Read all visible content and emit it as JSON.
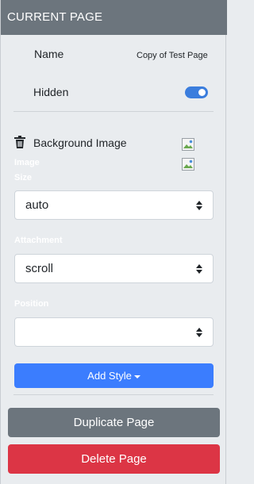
{
  "header": {
    "title": "CURRENT PAGE"
  },
  "page": {
    "name_label": "Name",
    "name_value": "Copy of Test Page",
    "hidden_label": "Hidden",
    "hidden_enabled": true
  },
  "background": {
    "title": "Background Image",
    "image_size_label_line1": "Image",
    "image_size_label_line2": "Size",
    "image_size_value": "auto",
    "attachment_label": "Attachment",
    "attachment_value": "scroll",
    "position_label": "Position",
    "position_value": ""
  },
  "actions": {
    "add_style_label": "Add Style",
    "duplicate_label": "Duplicate Page",
    "delete_label": "Delete Page"
  },
  "colors": {
    "header_bg": "#6c757d",
    "toggle_on": "#3b7ddd",
    "primary": "#3b7dfe",
    "danger": "#dc3545"
  },
  "icons": {
    "trash": "trash-icon",
    "broken_image": "broken-image-icon",
    "select_caret": "select-caret-icon",
    "dropdown_caret": "caret-down-icon"
  }
}
